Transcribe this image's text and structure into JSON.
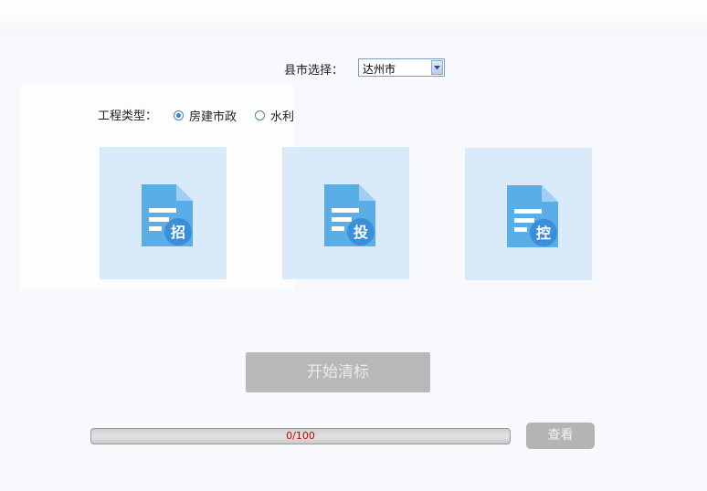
{
  "form": {
    "city_label": "县市选择：",
    "city_value": "达州市",
    "type_label": "工程类型：",
    "type_options": [
      {
        "label": "房建市政",
        "checked": true
      },
      {
        "label": "水利",
        "checked": false
      }
    ]
  },
  "cards": [
    {
      "glyph": "招",
      "icon": "bid-invitation-document-icon"
    },
    {
      "glyph": "投",
      "icon": "bid-submission-document-icon"
    },
    {
      "glyph": "控",
      "icon": "price-control-document-icon"
    }
  ],
  "actions": {
    "start_label": "开始清标",
    "view_label": "查看"
  },
  "progress": {
    "text": "0/100",
    "value": 0,
    "max": 100
  },
  "colors": {
    "card_bg": "#d9ebfa",
    "doc_icon": "#5aaee8",
    "progress_text": "#cc0000",
    "button_disabled": "#b8b8b8"
  }
}
